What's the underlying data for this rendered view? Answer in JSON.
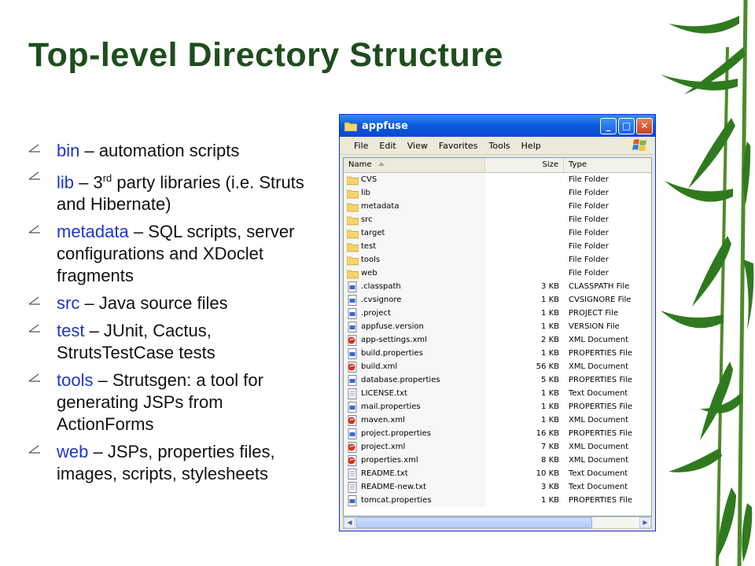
{
  "slide_title": "Top-level Directory Structure",
  "bullets": [
    {
      "keyword": "bin",
      "text": " – automation scripts"
    },
    {
      "keyword": "lib",
      "text_before_sup": " – 3",
      "sup": "rd",
      "text_after_sup": " party libraries (i.e. Struts and Hibernate)"
    },
    {
      "keyword": "metadata",
      "text": " – SQL scripts, server configurations and XDoclet fragments"
    },
    {
      "keyword": "src",
      "text": " – Java source files"
    },
    {
      "keyword": "test",
      "text": " – JUnit, Cactus, StrutsTestCase tests"
    },
    {
      "keyword": "tools",
      "text": " – Strutsgen: a tool for generating JSPs from ActionForms"
    },
    {
      "keyword": "web",
      "text": " – JSPs, properties files, images, scripts, stylesheets"
    }
  ],
  "explorer": {
    "title": "appfuse",
    "menu": [
      "File",
      "Edit",
      "View",
      "Favorites",
      "Tools",
      "Help"
    ],
    "columns": {
      "name": "Name",
      "size": "Size",
      "type": "Type"
    },
    "files": [
      {
        "name": "CVS",
        "size": "",
        "type": "File Folder",
        "icon": "folder"
      },
      {
        "name": "lib",
        "size": "",
        "type": "File Folder",
        "icon": "folder"
      },
      {
        "name": "metadata",
        "size": "",
        "type": "File Folder",
        "icon": "folder"
      },
      {
        "name": "src",
        "size": "",
        "type": "File Folder",
        "icon": "folder"
      },
      {
        "name": "target",
        "size": "",
        "type": "File Folder",
        "icon": "folder"
      },
      {
        "name": "test",
        "size": "",
        "type": "File Folder",
        "icon": "folder"
      },
      {
        "name": "tools",
        "size": "",
        "type": "File Folder",
        "icon": "folder"
      },
      {
        "name": "web",
        "size": "",
        "type": "File Folder",
        "icon": "folder"
      },
      {
        "name": ".classpath",
        "size": "3 KB",
        "type": "CLASSPATH File",
        "icon": "doc"
      },
      {
        "name": ".cvsignore",
        "size": "1 KB",
        "type": "CVSIGNORE File",
        "icon": "doc"
      },
      {
        "name": ".project",
        "size": "1 KB",
        "type": "PROJECT File",
        "icon": "doc"
      },
      {
        "name": "appfuse.version",
        "size": "1 KB",
        "type": "VERSION File",
        "icon": "doc"
      },
      {
        "name": "app-settings.xml",
        "size": "2 KB",
        "type": "XML Document",
        "icon": "xml"
      },
      {
        "name": "build.properties",
        "size": "1 KB",
        "type": "PROPERTIES File",
        "icon": "doc"
      },
      {
        "name": "build.xml",
        "size": "56 KB",
        "type": "XML Document",
        "icon": "xml"
      },
      {
        "name": "database.properties",
        "size": "5 KB",
        "type": "PROPERTIES File",
        "icon": "doc"
      },
      {
        "name": "LICENSE.txt",
        "size": "1 KB",
        "type": "Text Document",
        "icon": "txt"
      },
      {
        "name": "mail.properties",
        "size": "1 KB",
        "type": "PROPERTIES File",
        "icon": "doc"
      },
      {
        "name": "maven.xml",
        "size": "1 KB",
        "type": "XML Document",
        "icon": "xml"
      },
      {
        "name": "project.properties",
        "size": "16 KB",
        "type": "PROPERTIES File",
        "icon": "doc"
      },
      {
        "name": "project.xml",
        "size": "7 KB",
        "type": "XML Document",
        "icon": "xml"
      },
      {
        "name": "properties.xml",
        "size": "8 KB",
        "type": "XML Document",
        "icon": "xml"
      },
      {
        "name": "README.txt",
        "size": "10 KB",
        "type": "Text Document",
        "icon": "txt"
      },
      {
        "name": "README-new.txt",
        "size": "3 KB",
        "type": "Text Document",
        "icon": "txt"
      },
      {
        "name": "tomcat.properties",
        "size": "1 KB",
        "type": "PROPERTIES File",
        "icon": "doc"
      }
    ]
  },
  "colors": {
    "title": "#1e4d1e",
    "keyword": "#1f36c8",
    "bamboo": "#2f7a1e"
  }
}
